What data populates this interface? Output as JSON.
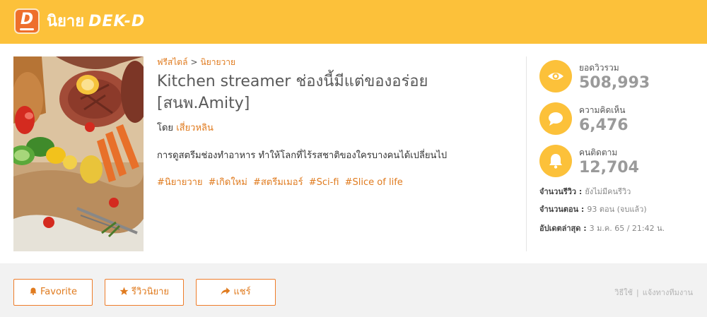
{
  "header": {
    "logo_letter": "D",
    "site_name": "นิยาย",
    "brand": "DEK-D"
  },
  "story": {
    "breadcrumb": [
      "ฟรีสไตล์",
      "นิยายวาย"
    ],
    "breadcrumb_sep": ">",
    "title": "Kitchen streamer ช่องนี้มีแต่ของอร่อย [สนพ.Amity]",
    "author_prefix": "โดย",
    "author": "เสี่ยวหลิน",
    "description": "การดูสตรีมช่องทำอาหาร ทำให้โลกที่ไร้รสชาติของใครบางคนได้เปลี่ยนไป",
    "tags": [
      "#นิยายวาย",
      "#เกิดใหม่",
      "#สตรีมเมอร์",
      "#Sci-fi",
      "#Slice of life"
    ]
  },
  "stats": [
    {
      "icon": "eye-icon",
      "label": "ยอดวิวรวม",
      "value": "508,993"
    },
    {
      "icon": "comment-icon",
      "label": "ความคิดเห็น",
      "value": "6,476"
    },
    {
      "icon": "bell-icon",
      "label": "คนติดตาม",
      "value": "12,704"
    }
  ],
  "meta": [
    {
      "key": "จำนวนรีวิว :",
      "value": "ยังไม่มีคนรีวิว"
    },
    {
      "key": "จำนวนตอน :",
      "value": "93 ตอน (จบแล้ว)"
    },
    {
      "key": "อัปเดตล่าสุด :",
      "value": "3 ม.ค. 65 / 21:42 น."
    }
  ],
  "actions": {
    "favorite": "Favorite",
    "review": "รีวิวนิยาย",
    "share": "แชร์"
  },
  "footer_links": {
    "howto": "วิธีใช้",
    "sep": "|",
    "report": "แจ้งทางทีมงาน"
  },
  "colors": {
    "header_bg": "#fcc13a",
    "accent": "#e07b1f",
    "logo_bg": "#ee6f2c"
  }
}
